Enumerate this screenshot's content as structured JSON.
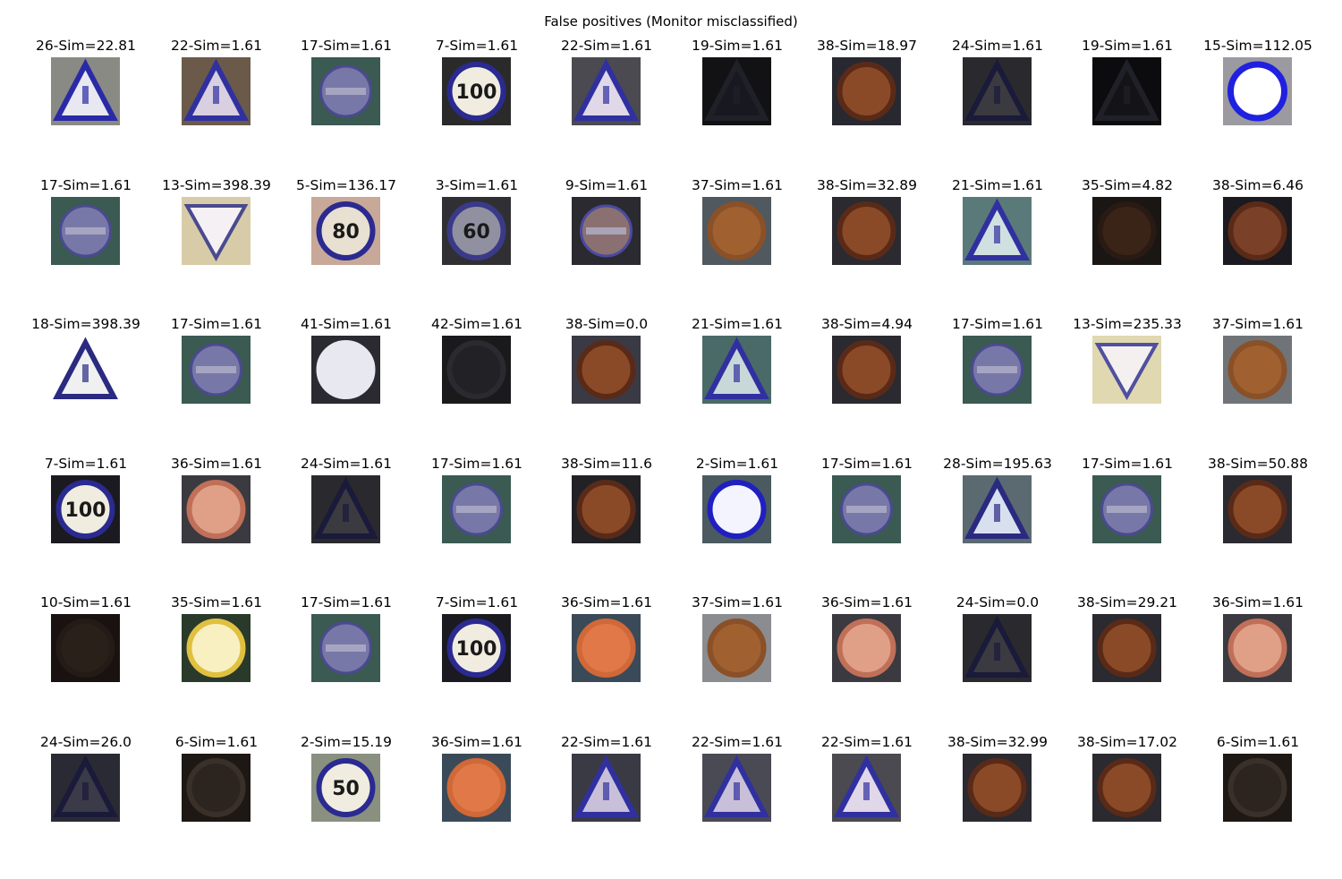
{
  "title": "False positives (Monitor misclassified)",
  "grid": {
    "rows": [
      [
        {
          "label": "26-Sim=22.81",
          "bg": "#8a8a84",
          "shape": "triangle",
          "fg": "#2a2aa8",
          "fill": "#e8e8f0"
        },
        {
          "label": "22-Sim=1.61",
          "bg": "#6b5a4a",
          "shape": "triangle",
          "fg": "#3030a0",
          "fill": "#d8d0e0"
        },
        {
          "label": "17-Sim=1.61",
          "bg": "#3a5a52",
          "shape": "noentry",
          "fg": "#4a4a90",
          "fill": "#7878a8"
        },
        {
          "label": "7-Sim=1.61",
          "bg": "#2a2a2a",
          "shape": "circle",
          "fg": "#2a2a90",
          "fill": "#f0ece0",
          "text": "100"
        },
        {
          "label": "22-Sim=1.61",
          "bg": "#4a4a50",
          "shape": "triangle",
          "fg": "#3030a0",
          "fill": "#e0d8e8"
        },
        {
          "label": "19-Sim=1.61",
          "bg": "#121214",
          "shape": "triangle",
          "fg": "#202028",
          "fill": "#181820"
        },
        {
          "label": "38-Sim=18.97",
          "bg": "#282830",
          "shape": "circle",
          "fg": "#5a2a18",
          "fill": "#8a4a28",
          "text": ""
        },
        {
          "label": "24-Sim=1.61",
          "bg": "#2a2a2e",
          "shape": "triangle",
          "fg": "#1a1a3a",
          "fill": "#3a3a40"
        },
        {
          "label": "19-Sim=1.61",
          "bg": "#0c0c0e",
          "shape": "triangle",
          "fg": "#202028",
          "fill": "#141418"
        },
        {
          "label": "15-Sim=112.05",
          "bg": "#9a9aa0",
          "shape": "ring",
          "fg": "#2020e0",
          "fill": "#ffffff"
        }
      ],
      [
        {
          "label": "17-Sim=1.61",
          "bg": "#3a5a52",
          "shape": "noentry",
          "fg": "#4a4a90",
          "fill": "#7878a8"
        },
        {
          "label": "13-Sim=398.39",
          "bg": "#d8cca8",
          "shape": "yield",
          "fg": "#4a4a90",
          "fill": "#f4f0f4"
        },
        {
          "label": "5-Sim=136.17",
          "bg": "#c8a898",
          "shape": "circle",
          "fg": "#2a2a90",
          "fill": "#e8e0d0",
          "text": "80"
        },
        {
          "label": "3-Sim=1.61",
          "bg": "#303034",
          "shape": "circle",
          "fg": "#3a3a88",
          "fill": "#9090a0",
          "text": "60"
        },
        {
          "label": "9-Sim=1.61",
          "bg": "#2a2a30",
          "shape": "noentry",
          "fg": "#4a4aa0",
          "fill": "#8a7070"
        },
        {
          "label": "37-Sim=1.61",
          "bg": "#505860",
          "shape": "circle",
          "fg": "#8a5028",
          "fill": "#a06030",
          "text": ""
        },
        {
          "label": "38-Sim=32.89",
          "bg": "#2a2a30",
          "shape": "circle",
          "fg": "#5a2a18",
          "fill": "#8a4a28",
          "text": ""
        },
        {
          "label": "21-Sim=1.61",
          "bg": "#5a7a7a",
          "shape": "triangle",
          "fg": "#3030a0",
          "fill": "#d0e0e0"
        },
        {
          "label": "35-Sim=4.82",
          "bg": "#1a1614",
          "shape": "circle",
          "fg": "#2a1a14",
          "fill": "#3a2418",
          "text": ""
        },
        {
          "label": "38-Sim=6.46",
          "bg": "#1a1a20",
          "shape": "circle",
          "fg": "#5a2a18",
          "fill": "#7a4028",
          "text": ""
        }
      ],
      [
        {
          "label": "18-Sim=398.39",
          "bg": "#ffffff",
          "shape": "triangle",
          "fg": "#2a2a80",
          "fill": "#f0f0f0"
        },
        {
          "label": "17-Sim=1.61",
          "bg": "#3a5a52",
          "shape": "noentry",
          "fg": "#4a4a90",
          "fill": "#7878a8"
        },
        {
          "label": "41-Sim=1.61",
          "bg": "#2a2a30",
          "shape": "circle",
          "fg": "#e8e8f0",
          "fill": "#e8e8f0",
          "text": ""
        },
        {
          "label": "42-Sim=1.61",
          "bg": "#1a1a1c",
          "shape": "circle",
          "fg": "#2a2a30",
          "fill": "#222226",
          "text": ""
        },
        {
          "label": "38-Sim=0.0",
          "bg": "#3a3a44",
          "shape": "circle",
          "fg": "#5a2a18",
          "fill": "#8a4a28",
          "text": ""
        },
        {
          "label": "21-Sim=1.61",
          "bg": "#4a6a68",
          "shape": "triangle",
          "fg": "#3030a0",
          "fill": "#c8d8d8"
        },
        {
          "label": "38-Sim=4.94",
          "bg": "#2a2a30",
          "shape": "circle",
          "fg": "#5a2a18",
          "fill": "#8a4a28",
          "text": ""
        },
        {
          "label": "17-Sim=1.61",
          "bg": "#3a5a52",
          "shape": "noentry",
          "fg": "#4a4a90",
          "fill": "#7878a8"
        },
        {
          "label": "13-Sim=235.33",
          "bg": "#e0d8b0",
          "shape": "yield",
          "fg": "#5050a0",
          "fill": "#f4f0f0"
        },
        {
          "label": "37-Sim=1.61",
          "bg": "#707478",
          "shape": "circle",
          "fg": "#8a5028",
          "fill": "#a06030",
          "text": ""
        }
      ],
      [
        {
          "label": "7-Sim=1.61",
          "bg": "#1a1a20",
          "shape": "circle",
          "fg": "#2a2a90",
          "fill": "#f0ece0",
          "text": "100"
        },
        {
          "label": "36-Sim=1.61",
          "bg": "#3a3a40",
          "shape": "circle",
          "fg": "#c07058",
          "fill": "#e0a088",
          "text": ""
        },
        {
          "label": "24-Sim=1.61",
          "bg": "#2a2a2e",
          "shape": "triangle",
          "fg": "#1a1a3a",
          "fill": "#3a3a40"
        },
        {
          "label": "17-Sim=1.61",
          "bg": "#3a5a52",
          "shape": "noentry",
          "fg": "#4a4a90",
          "fill": "#7878a8"
        },
        {
          "label": "38-Sim=11.6",
          "bg": "#222226",
          "shape": "circle",
          "fg": "#5a2a18",
          "fill": "#8a4a28",
          "text": ""
        },
        {
          "label": "2-Sim=1.61",
          "bg": "#4a5a60",
          "shape": "circle",
          "fg": "#2020c0",
          "fill": "#f4f4ff",
          "text": ""
        },
        {
          "label": "17-Sim=1.61",
          "bg": "#3a5a52",
          "shape": "noentry",
          "fg": "#4a4a90",
          "fill": "#7878a8"
        },
        {
          "label": "28-Sim=195.63",
          "bg": "#5a6a70",
          "shape": "triangle",
          "fg": "#2a2a80",
          "fill": "#d8e0f0"
        },
        {
          "label": "17-Sim=1.61",
          "bg": "#3a5a52",
          "shape": "noentry",
          "fg": "#4a4a90",
          "fill": "#7878a8"
        },
        {
          "label": "38-Sim=50.88",
          "bg": "#2a2a30",
          "shape": "circle",
          "fg": "#5a2a18",
          "fill": "#8a4a28",
          "text": ""
        }
      ],
      [
        {
          "label": "10-Sim=1.61",
          "bg": "#1a1210",
          "shape": "circle",
          "fg": "#241a16",
          "fill": "#2a201a",
          "text": ""
        },
        {
          "label": "35-Sim=1.61",
          "bg": "#2a3a2a",
          "shape": "circle",
          "fg": "#e0c040",
          "fill": "#f8f0c0",
          "text": ""
        },
        {
          "label": "17-Sim=1.61",
          "bg": "#3a5a52",
          "shape": "noentry",
          "fg": "#4a4a90",
          "fill": "#7878a8"
        },
        {
          "label": "7-Sim=1.61",
          "bg": "#1a1a20",
          "shape": "circle",
          "fg": "#2a2a90",
          "fill": "#f0ece0",
          "text": "100"
        },
        {
          "label": "36-Sim=1.61",
          "bg": "#3a4a58",
          "shape": "circle",
          "fg": "#d06838",
          "fill": "#e07848",
          "text": ""
        },
        {
          "label": "37-Sim=1.61",
          "bg": "#8a8c90",
          "shape": "circle",
          "fg": "#8a5028",
          "fill": "#a06030",
          "text": ""
        },
        {
          "label": "36-Sim=1.61",
          "bg": "#3a3a40",
          "shape": "circle",
          "fg": "#c07058",
          "fill": "#e0a088",
          "text": ""
        },
        {
          "label": "24-Sim=0.0",
          "bg": "#2a2a2e",
          "shape": "triangle",
          "fg": "#1a1a3a",
          "fill": "#3a3a40"
        },
        {
          "label": "38-Sim=29.21",
          "bg": "#2a2a30",
          "shape": "circle",
          "fg": "#5a2a18",
          "fill": "#8a4a28",
          "text": ""
        },
        {
          "label": "36-Sim=1.61",
          "bg": "#3a3a40",
          "shape": "circle",
          "fg": "#c07058",
          "fill": "#e0a088",
          "text": ""
        }
      ],
      [
        {
          "label": "24-Sim=26.0",
          "bg": "#2a2a34",
          "shape": "triangle",
          "fg": "#1a1a3a",
          "fill": "#3a3a48"
        },
        {
          "label": "6-Sim=1.61",
          "bg": "#1e1814",
          "shape": "circle",
          "fg": "#3a302a",
          "fill": "#2c241e",
          "text": ""
        },
        {
          "label": "2-Sim=15.19",
          "bg": "#8a9080",
          "shape": "circle",
          "fg": "#2a2a90",
          "fill": "#f0ece0",
          "text": "50"
        },
        {
          "label": "36-Sim=1.61",
          "bg": "#3a4a58",
          "shape": "circle",
          "fg": "#d06838",
          "fill": "#e07848",
          "text": ""
        },
        {
          "label": "22-Sim=1.61",
          "bg": "#3a3a44",
          "shape": "triangle",
          "fg": "#3030a0",
          "fill": "#c8c0d8"
        },
        {
          "label": "22-Sim=1.61",
          "bg": "#4a4a54",
          "shape": "triangle",
          "fg": "#3030a0",
          "fill": "#c8c0d8"
        },
        {
          "label": "22-Sim=1.61",
          "bg": "#4a4a50",
          "shape": "triangle",
          "fg": "#3030a0",
          "fill": "#e0d8e8"
        },
        {
          "label": "38-Sim=32.99",
          "bg": "#2a2a30",
          "shape": "circle",
          "fg": "#5a2a18",
          "fill": "#8a4a28",
          "text": ""
        },
        {
          "label": "38-Sim=17.02",
          "bg": "#2a2a30",
          "shape": "circle",
          "fg": "#5a2a18",
          "fill": "#8a4a28",
          "text": ""
        },
        {
          "label": "6-Sim=1.61",
          "bg": "#1e1814",
          "shape": "circle",
          "fg": "#3a302a",
          "fill": "#2c241e",
          "text": ""
        }
      ]
    ]
  }
}
